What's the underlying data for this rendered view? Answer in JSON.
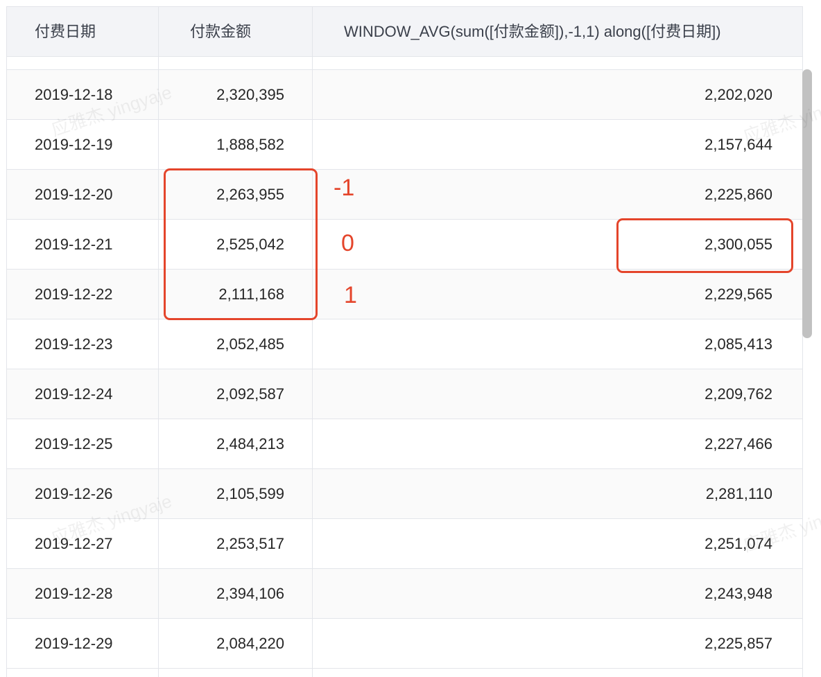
{
  "columns": [
    "付费日期",
    "付款金额",
    "WINDOW_AVG(sum([付款金额]),-1,1) along([付费日期])"
  ],
  "rows": [
    {
      "date": "2019-12-18",
      "amount": "2,320,395",
      "avg": "2,202,020"
    },
    {
      "date": "2019-12-19",
      "amount": "1,888,582",
      "avg": "2,157,644"
    },
    {
      "date": "2019-12-20",
      "amount": "2,263,955",
      "avg": "2,225,860"
    },
    {
      "date": "2019-12-21",
      "amount": "2,525,042",
      "avg": "2,300,055"
    },
    {
      "date": "2019-12-22",
      "amount": "2,111,168",
      "avg": "2,229,565"
    },
    {
      "date": "2019-12-23",
      "amount": "2,052,485",
      "avg": "2,085,413"
    },
    {
      "date": "2019-12-24",
      "amount": "2,092,587",
      "avg": "2,209,762"
    },
    {
      "date": "2019-12-25",
      "amount": "2,484,213",
      "avg": "2,227,466"
    },
    {
      "date": "2019-12-26",
      "amount": "2,105,599",
      "avg": "2,281,110"
    },
    {
      "date": "2019-12-27",
      "amount": "2,253,517",
      "avg": "2,251,074"
    },
    {
      "date": "2019-12-28",
      "amount": "2,394,106",
      "avg": "2,243,948"
    },
    {
      "date": "2019-12-29",
      "amount": "2,084,220",
      "avg": "2,225,857"
    }
  ],
  "annotations": {
    "offsets": [
      "-1",
      "0",
      "1"
    ],
    "color": "#e4452b"
  },
  "watermark": "应雅杰 yingyaje"
}
